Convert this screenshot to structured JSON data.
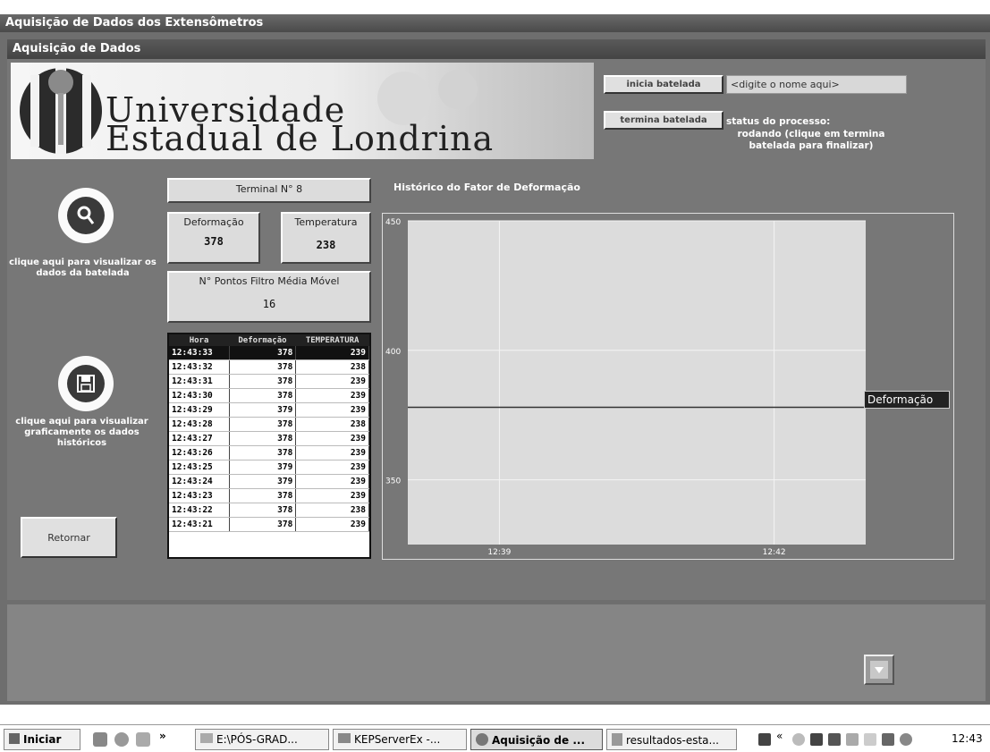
{
  "window": {
    "title": "Aquisição de Dados dos Extensômetros"
  },
  "form": {
    "title": "Aquisição de Dados"
  },
  "banner": {
    "line1": "Universidade",
    "line2": "Estadual de Londrina"
  },
  "batch": {
    "start_label": "inicia batelada",
    "name_input_value": "<digite o nome aqui>",
    "stop_label": "termina batelada",
    "status_label": "status do processo:",
    "status_text": "rodando (clique em termina batelada para finalizar)"
  },
  "terminal": {
    "label": "Terminal N° 8"
  },
  "deformation": {
    "label": "Deformação",
    "value": "378"
  },
  "temperature": {
    "label": "Temperatura",
    "value": "238"
  },
  "filter": {
    "label": "N° Pontos Filtro Média Móvel",
    "value": "16"
  },
  "sidebar": {
    "view_batch_text": "clique aqui para visualizar os dados da batelada",
    "view_history_text": "clique aqui para visualizar graficamente os dados históricos",
    "return_label": "Retornar"
  },
  "table": {
    "headers": [
      "Hora",
      "Deformação",
      "TEMPERATURA"
    ],
    "rows": [
      [
        "12:43:33",
        "378",
        "239"
      ],
      [
        "12:43:32",
        "378",
        "238"
      ],
      [
        "12:43:31",
        "378",
        "239"
      ],
      [
        "12:43:30",
        "378",
        "239"
      ],
      [
        "12:43:29",
        "379",
        "239"
      ],
      [
        "12:43:28",
        "378",
        "238"
      ],
      [
        "12:43:27",
        "378",
        "239"
      ],
      [
        "12:43:26",
        "378",
        "239"
      ],
      [
        "12:43:25",
        "379",
        "239"
      ],
      [
        "12:43:24",
        "379",
        "239"
      ],
      [
        "12:43:23",
        "378",
        "239"
      ],
      [
        "12:43:22",
        "378",
        "238"
      ],
      [
        "12:43:21",
        "378",
        "239"
      ]
    ]
  },
  "chart_data": {
    "type": "line",
    "title": "Histórico do Fator de Deformação",
    "xlabel": "",
    "ylabel": "",
    "ylim": [
      325,
      450
    ],
    "y_ticks": [
      350,
      400,
      450
    ],
    "x_ticks": [
      "12:39",
      "12:42"
    ],
    "x_range_minutes": [
      "12:38",
      "12:43"
    ],
    "grid": true,
    "legend_position": "right",
    "series": [
      {
        "name": "Deformação",
        "x": [
          "12:38",
          "12:43"
        ],
        "values": [
          378,
          378
        ]
      }
    ]
  },
  "taskbar": {
    "start_label": "Iniciar",
    "chevron": "»",
    "items": [
      "E:\\PÓS-GRAD...",
      "KEPServerEx -...",
      "Aquisição de ...",
      "resultados-esta..."
    ],
    "tray_chevron": "«",
    "clock": "12:43"
  },
  "colors": {
    "window_bg": "#6e6e6e",
    "chart_plot_bg": "#dcdcdc",
    "series_line": "#333333"
  }
}
